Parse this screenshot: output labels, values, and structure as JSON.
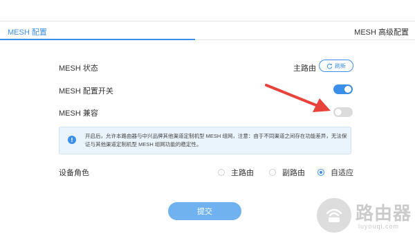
{
  "tabs": {
    "active": "MESH 配置",
    "other": "MESH 高级配置"
  },
  "rows": {
    "status_label": "MESH 状态",
    "status_value": "主路由",
    "refresh_label": "刷新",
    "switch_label": "MESH 配置开关",
    "switch_on": true,
    "compat_label": "MESH 兼容",
    "compat_on": false
  },
  "info": {
    "text": "开启后，允许本路由器与中兴品牌其他渠道定制机型 MESH 组网，注意：由于不同渠道之间存在功能差异，无法保证与其他渠道定制机型 MESH 组网功能的稳定性。"
  },
  "role": {
    "label": "设备角色",
    "options": [
      "主路由",
      "副路由",
      "自适应"
    ],
    "selected": "自适应"
  },
  "submit_label": "提交",
  "watermark": {
    "main": "路由器",
    "sub": "luyouqi.com"
  },
  "colors": {
    "accent": "#3b8fe8",
    "arrow": "#e8433a"
  }
}
